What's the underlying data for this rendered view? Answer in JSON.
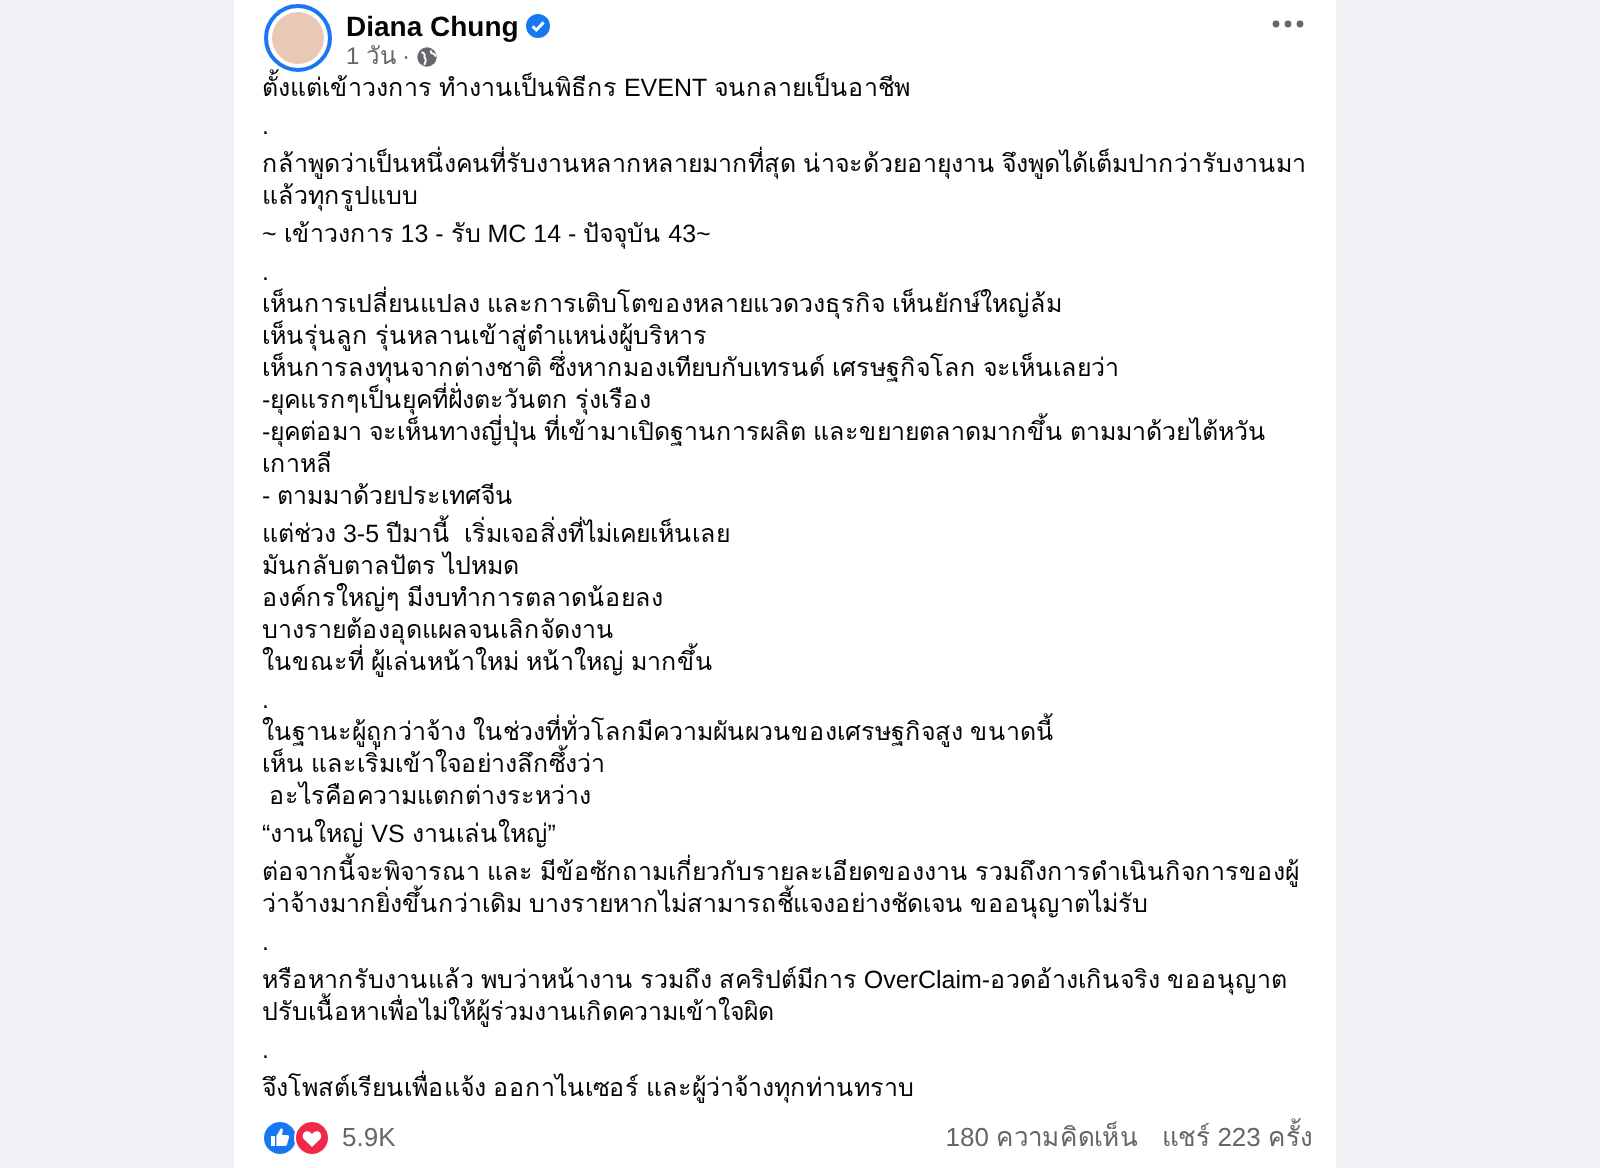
{
  "author": {
    "name": "Diana Chung",
    "verified": true
  },
  "timestamp": "1 วัน",
  "meta_separator": "·",
  "paragraphs": [
    "ตั้งแต่เข้าวงการ ทำงานเป็นพิธีกร EVENT จนกลายเป็นอาชีพ",
    ".",
    "กล้าพูดว่าเป็นหนึ่งคนที่รับงานหลากหลายมากที่สุด น่าจะด้วยอายุงาน จึงพูดได้เต็มปากว่ารับงานมาแล้วทุกรูปแบบ",
    "~ เข้าวงการ 13 - รับ MC 14 - ปัจจุบัน 43~",
    ".\nเห็นการเปลี่ยนแปลง และการเติบโตของหลายแวดวงธุรกิจ เห็นยักษ์ใหญ่ล้ม\nเห็นรุ่นลูก รุ่นหลานเข้าสู่ตำแหน่งผู้บริหาร\nเห็นการลงทุนจากต่างชาติ ซึ่งหากมองเทียบกับเทรนด์ เศรษฐกิจโลก จะเห็นเลยว่า\n-ยุคแรกๆเป็นยุคที่ฝั่งตะวันตก รุ่งเรือง\n-ยุคต่อมา จะเห็นทางญี่ปุ่น ที่เข้ามาเปิดฐานการผลิต และขยายตลาดมากขึ้น ตามมาด้วยไต้หวัน เกาหลี\n- ตามมาด้วยประเทศจีน",
    "แต่ช่วง 3-5 ปีมานี้  เริ่มเจอสิ่งที่ไม่เคยเห็นเลย\nมันกลับตาลปัตร ไปหมด\nองค์กรใหญ่ๆ มีงบทำการตลาดน้อยลง\nบางรายต้องอุดแผลจนเลิกจัดงาน\nในขณะที่ ผู้เล่นหน้าใหม่ หน้าใหญ่ มากขึ้น",
    ".\nในฐานะผู้ถูกว่าจ้าง ในช่วงที่ทั่วโลกมีความผันผวนของเศรษฐกิจสูง ขนาดนี้\nเห็น และเริ่มเข้าใจอย่างลึกซึ้งว่า\n อะไรคือความแตกต่างระหว่าง",
    "“งานใหญ่ VS งานเล่นใหญ่”",
    "ต่อจากนี้จะพิจารณา และ มีข้อซักถามเกี่ยวกับรายละเอียดของงาน รวมถึงการดำเนินกิจการของผู้ว่าจ้างมากยิ่งขึ้นกว่าเดิม บางรายหากไม่สามารถชี้แจงอย่างชัดเจน ขออนุญาตไม่รับ",
    ".",
    "หรือหากรับงานแล้ว พบว่าหน้างาน รวมถึง สคริปต์มีการ OverClaim-อวดอ้างเกินจริง ขออนุญาตปรับเนื้อหาเพื่อไม่ให้ผู้ร่วมงานเกิดความเข้าใจผิด",
    ".",
    "จึงโพสต์เรียนเพื่อแจ้ง ออกาไนเซอร์ และผู้ว่าจ้างทุกท่านทราบ"
  ],
  "reactions": {
    "count": "5.9K"
  },
  "comments": "180 ความคิดเห็น",
  "shares": "แชร์ 223 ครั้ง"
}
